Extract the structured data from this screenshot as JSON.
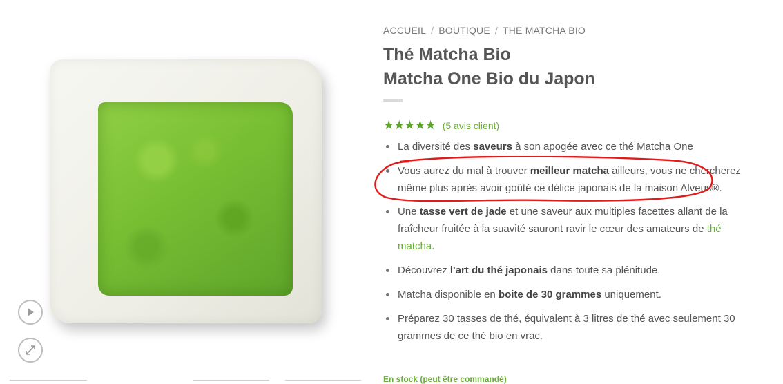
{
  "breadcrumb": {
    "items": [
      "ACCUEIL",
      "BOUTIQUE",
      "THÉ MATCHA BIO"
    ],
    "separator": "/"
  },
  "product": {
    "title_line1": "Thé Matcha Bio",
    "title_line2": "Matcha One Bio du Japon",
    "rating": {
      "stars": "★★★★★",
      "reviews_label": "(5 avis client)"
    },
    "bullets": [
      {
        "pre": "La diversité des ",
        "bold": "saveurs",
        "post": " à son apogée avec ce thé Matcha One"
      },
      {
        "pre": "Vous aurez du mal à trouver ",
        "bold": "meilleur matcha",
        "post": " ailleurs, vous ne chercherez même plus après avoir goûté ce délice japonais de la maison Alveus®."
      },
      {
        "pre": "Une ",
        "bold": "tasse vert de jade",
        "mid": " et une saveur aux multiples facettes allant de la fraîcheur fruitée à la suavité sauront ravir le cœur des amateurs de ",
        "link": "thé matcha",
        "post": "."
      },
      {
        "pre": "Découvrez ",
        "bold": "l'art du thé japonais",
        "post": " dans toute sa plénitude."
      },
      {
        "pre": "Matcha disponible en ",
        "bold": "boite de 30 grammes",
        "post": " uniquement."
      },
      {
        "pre": "Préparez 30 tasses de thé, équivalent à 3 litres de thé avec seulement 30 grammes de ce thé bio en vrac."
      }
    ],
    "stock": "En stock (peut être commandé)"
  },
  "icons": {
    "play": "play-icon",
    "zoom": "expand-icon",
    "rating": "star-icon"
  },
  "colors": {
    "accent_green": "#6aae3a",
    "star_green": "#5aa62a",
    "annotation_red": "#e01b1b",
    "text": "#555555"
  }
}
